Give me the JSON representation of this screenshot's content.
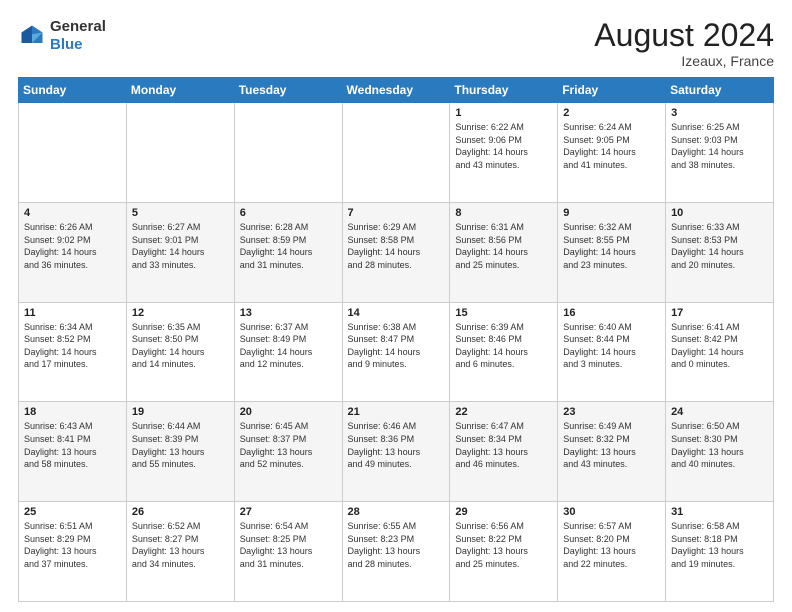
{
  "header": {
    "logo_general": "General",
    "logo_blue": "Blue",
    "month_year": "August 2024",
    "location": "Izeaux, France"
  },
  "days_of_week": [
    "Sunday",
    "Monday",
    "Tuesday",
    "Wednesday",
    "Thursday",
    "Friday",
    "Saturday"
  ],
  "weeks": [
    [
      {
        "day": "",
        "info": ""
      },
      {
        "day": "",
        "info": ""
      },
      {
        "day": "",
        "info": ""
      },
      {
        "day": "",
        "info": ""
      },
      {
        "day": "1",
        "info": "Sunrise: 6:22 AM\nSunset: 9:06 PM\nDaylight: 14 hours\nand 43 minutes."
      },
      {
        "day": "2",
        "info": "Sunrise: 6:24 AM\nSunset: 9:05 PM\nDaylight: 14 hours\nand 41 minutes."
      },
      {
        "day": "3",
        "info": "Sunrise: 6:25 AM\nSunset: 9:03 PM\nDaylight: 14 hours\nand 38 minutes."
      }
    ],
    [
      {
        "day": "4",
        "info": "Sunrise: 6:26 AM\nSunset: 9:02 PM\nDaylight: 14 hours\nand 36 minutes."
      },
      {
        "day": "5",
        "info": "Sunrise: 6:27 AM\nSunset: 9:01 PM\nDaylight: 14 hours\nand 33 minutes."
      },
      {
        "day": "6",
        "info": "Sunrise: 6:28 AM\nSunset: 8:59 PM\nDaylight: 14 hours\nand 31 minutes."
      },
      {
        "day": "7",
        "info": "Sunrise: 6:29 AM\nSunset: 8:58 PM\nDaylight: 14 hours\nand 28 minutes."
      },
      {
        "day": "8",
        "info": "Sunrise: 6:31 AM\nSunset: 8:56 PM\nDaylight: 14 hours\nand 25 minutes."
      },
      {
        "day": "9",
        "info": "Sunrise: 6:32 AM\nSunset: 8:55 PM\nDaylight: 14 hours\nand 23 minutes."
      },
      {
        "day": "10",
        "info": "Sunrise: 6:33 AM\nSunset: 8:53 PM\nDaylight: 14 hours\nand 20 minutes."
      }
    ],
    [
      {
        "day": "11",
        "info": "Sunrise: 6:34 AM\nSunset: 8:52 PM\nDaylight: 14 hours\nand 17 minutes."
      },
      {
        "day": "12",
        "info": "Sunrise: 6:35 AM\nSunset: 8:50 PM\nDaylight: 14 hours\nand 14 minutes."
      },
      {
        "day": "13",
        "info": "Sunrise: 6:37 AM\nSunset: 8:49 PM\nDaylight: 14 hours\nand 12 minutes."
      },
      {
        "day": "14",
        "info": "Sunrise: 6:38 AM\nSunset: 8:47 PM\nDaylight: 14 hours\nand 9 minutes."
      },
      {
        "day": "15",
        "info": "Sunrise: 6:39 AM\nSunset: 8:46 PM\nDaylight: 14 hours\nand 6 minutes."
      },
      {
        "day": "16",
        "info": "Sunrise: 6:40 AM\nSunset: 8:44 PM\nDaylight: 14 hours\nand 3 minutes."
      },
      {
        "day": "17",
        "info": "Sunrise: 6:41 AM\nSunset: 8:42 PM\nDaylight: 14 hours\nand 0 minutes."
      }
    ],
    [
      {
        "day": "18",
        "info": "Sunrise: 6:43 AM\nSunset: 8:41 PM\nDaylight: 13 hours\nand 58 minutes."
      },
      {
        "day": "19",
        "info": "Sunrise: 6:44 AM\nSunset: 8:39 PM\nDaylight: 13 hours\nand 55 minutes."
      },
      {
        "day": "20",
        "info": "Sunrise: 6:45 AM\nSunset: 8:37 PM\nDaylight: 13 hours\nand 52 minutes."
      },
      {
        "day": "21",
        "info": "Sunrise: 6:46 AM\nSunset: 8:36 PM\nDaylight: 13 hours\nand 49 minutes."
      },
      {
        "day": "22",
        "info": "Sunrise: 6:47 AM\nSunset: 8:34 PM\nDaylight: 13 hours\nand 46 minutes."
      },
      {
        "day": "23",
        "info": "Sunrise: 6:49 AM\nSunset: 8:32 PM\nDaylight: 13 hours\nand 43 minutes."
      },
      {
        "day": "24",
        "info": "Sunrise: 6:50 AM\nSunset: 8:30 PM\nDaylight: 13 hours\nand 40 minutes."
      }
    ],
    [
      {
        "day": "25",
        "info": "Sunrise: 6:51 AM\nSunset: 8:29 PM\nDaylight: 13 hours\nand 37 minutes."
      },
      {
        "day": "26",
        "info": "Sunrise: 6:52 AM\nSunset: 8:27 PM\nDaylight: 13 hours\nand 34 minutes."
      },
      {
        "day": "27",
        "info": "Sunrise: 6:54 AM\nSunset: 8:25 PM\nDaylight: 13 hours\nand 31 minutes."
      },
      {
        "day": "28",
        "info": "Sunrise: 6:55 AM\nSunset: 8:23 PM\nDaylight: 13 hours\nand 28 minutes."
      },
      {
        "day": "29",
        "info": "Sunrise: 6:56 AM\nSunset: 8:22 PM\nDaylight: 13 hours\nand 25 minutes."
      },
      {
        "day": "30",
        "info": "Sunrise: 6:57 AM\nSunset: 8:20 PM\nDaylight: 13 hours\nand 22 minutes."
      },
      {
        "day": "31",
        "info": "Sunrise: 6:58 AM\nSunset: 8:18 PM\nDaylight: 13 hours\nand 19 minutes."
      }
    ]
  ]
}
